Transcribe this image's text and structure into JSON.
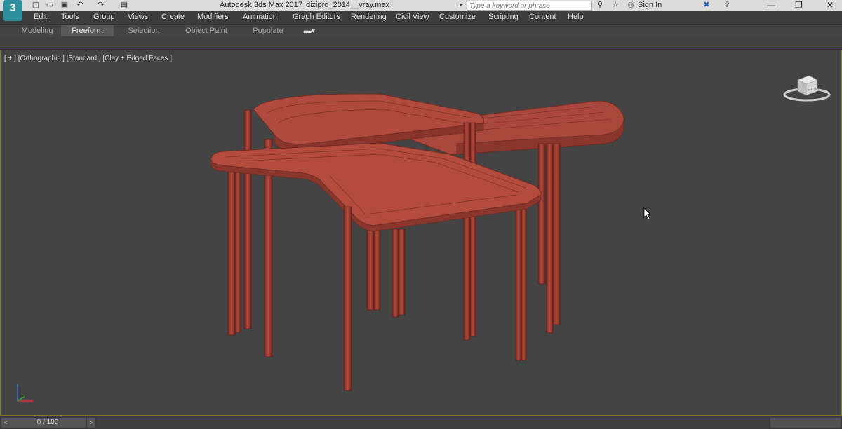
{
  "app": {
    "logo": "3",
    "title": "Autodesk 3ds Max 2017",
    "file": "dizipro_2014__vray.max"
  },
  "quick_access": [
    {
      "icon": "new-file-icon",
      "glyph": "▢"
    },
    {
      "icon": "open-file-icon",
      "glyph": "▭"
    },
    {
      "icon": "save-icon",
      "glyph": "▣"
    },
    {
      "icon": "undo-icon",
      "glyph": "↶"
    },
    {
      "icon": "redo-icon",
      "glyph": "↷"
    },
    {
      "icon": "project-icon",
      "glyph": "▤"
    }
  ],
  "search": {
    "placeholder": "Type a keyword or phrase"
  },
  "account": {
    "sign_in": "Sign In"
  },
  "window_controls": {
    "minimize": "—",
    "maximize": "❐",
    "close": "✕"
  },
  "menu": [
    "Edit",
    "Tools",
    "Group",
    "Views",
    "Create",
    "Modifiers",
    "Animation",
    "Graph Editors",
    "Rendering",
    "Civil View",
    "Customize",
    "Scripting",
    "Content",
    "Help"
  ],
  "ribbon_tabs": [
    {
      "label": "Modeling",
      "active": false
    },
    {
      "label": "Freeform",
      "active": true
    },
    {
      "label": "Selection",
      "active": false
    },
    {
      "label": "Object Paint",
      "active": false
    },
    {
      "label": "Populate",
      "active": false
    }
  ],
  "viewport": {
    "label": "[ + ] [Orthographic ] [Standard ] [Clay + Edged Faces ]",
    "viewcube_face": "FRONT",
    "model_color": "#b2463a",
    "highlight": "#7f7a2a"
  },
  "timeline": {
    "frame": "0 / 100",
    "prev": "<",
    "next": ">"
  }
}
